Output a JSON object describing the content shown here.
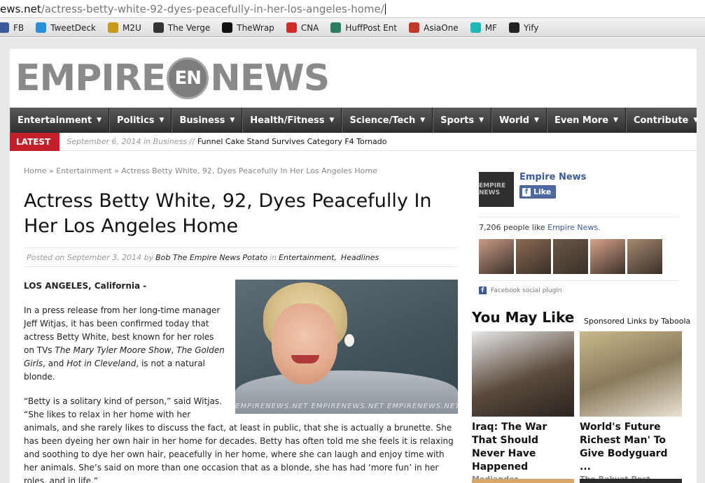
{
  "browser": {
    "url_domain": "ews.net",
    "url_path": "/actress-betty-white-92-dyes-peacefully-in-her-los-angeles-home/",
    "bookmarks": [
      {
        "label": "FB",
        "icon": "facebook-icon",
        "color": "#3b5998"
      },
      {
        "label": "TweetDeck",
        "icon": "tweetdeck-icon",
        "color": "#2a8fd6"
      },
      {
        "label": "M2U",
        "icon": "m2u-icon",
        "color": "#c89a18"
      },
      {
        "label": "The Verge",
        "icon": "verge-icon",
        "color": "#333333"
      },
      {
        "label": "TheWrap",
        "icon": "thewrap-icon",
        "color": "#111111"
      },
      {
        "label": "CNA",
        "icon": "cna-icon",
        "color": "#d12b2b"
      },
      {
        "label": "HuffPost Ent",
        "icon": "huffpost-icon",
        "color": "#2e7c62"
      },
      {
        "label": "AsiaOne",
        "icon": "asiaone-icon",
        "color": "#c0392b"
      },
      {
        "label": "MF",
        "icon": "mf-icon",
        "color": "#1fb6b6"
      },
      {
        "label": "Yify",
        "icon": "yify-icon",
        "color": "#222222"
      }
    ]
  },
  "site": {
    "logo_left": "EMPIRE",
    "logo_globe": "EN",
    "logo_right": "NEWS",
    "nav": [
      {
        "label": "Entertainment",
        "dropdown": true
      },
      {
        "label": "Politics",
        "dropdown": true
      },
      {
        "label": "Business",
        "dropdown": true
      },
      {
        "label": "Health/Fitness",
        "dropdown": true
      },
      {
        "label": "Science/Tech",
        "dropdown": true
      },
      {
        "label": "Sports",
        "dropdown": true
      },
      {
        "label": "World",
        "dropdown": true
      },
      {
        "label": "Even More",
        "dropdown": true
      }
    ],
    "nav_contribute": "Contribute",
    "latest": {
      "tag": "LATEST",
      "meta": "September 6, 2014 in Business //",
      "title": "Funnel Cake Stand Survives Category F4 Tornado"
    }
  },
  "article": {
    "breadcrumb": "Home » Entertainment » Actress Betty White, 92, Dyes Peacefully In Her Los Angeles Home",
    "headline": "Actress Betty White, 92, Dyes Peacefully In Her Los Angeles Home",
    "posted_on": "Posted on September 3, 2014 by",
    "author": "Bob The Empire News Potato",
    "in": "in",
    "cat1": "Entertainment",
    "comma": ",",
    "cat2": "Headlines",
    "dateline": "LOS ANGELES, California -",
    "p1_a": "In a press release from her long-time manager Jeff Witjas, it has been confirmed today that actress Betty White, best known for her roles on TVs ",
    "p1_show1": "The Mary Tyler Moore Show",
    "p1_sep1": ", ",
    "p1_show2": "The Golden Girls",
    "p1_sep2": ", and ",
    "p1_show3": "Hot in Cleveland",
    "p1_end": ", is not a natural blonde.",
    "p2": "“Betty is a solitary kind of person,” said Witjas. “She likes to relax in her home with her animals, and she rarely likes to discuss the fact, at least in public, that she is actually a brunette. She has been dyeing her own hair in her home for decades. Betty has often told me she feels it is relaxing and soothing to dye her own hair, peacefully in her home, where she can laugh and enjoy time with her animals. She’s said on more than one occasion that as a blonde, she has had ‘more fun’ in her roles, and in life.”",
    "image_watermark": "EMPIRENEWS.NET    EMPIRENEWS.NET    EMPIRENEWS.NET"
  },
  "sidebar": {
    "fb_logo": "EMPIRE NEWS",
    "fb_page_name": "Empire News",
    "fb_like_label": "Like",
    "fb_count_text": "7,206 people like",
    "fb_count_link": "Empire News.",
    "fb_face_colors": [
      "#c99a86",
      "#8a6a52",
      "#6b5848",
      "#d9a38a",
      "#a5896f"
    ],
    "fb_plugin": "Facebook social plugin",
    "you_may_like": "You May Like",
    "sponsored": "Sponsored Links by Taboola",
    "cards": [
      {
        "title": "Iraq: The War That Should Never Have Happened",
        "source": "Mediander",
        "color": "#5a4a3c"
      },
      {
        "title": "World's Future Richest Man' To Give Bodyguard ...",
        "source": "The Rakyat Post",
        "color": "#8a7a5c"
      }
    ]
  }
}
